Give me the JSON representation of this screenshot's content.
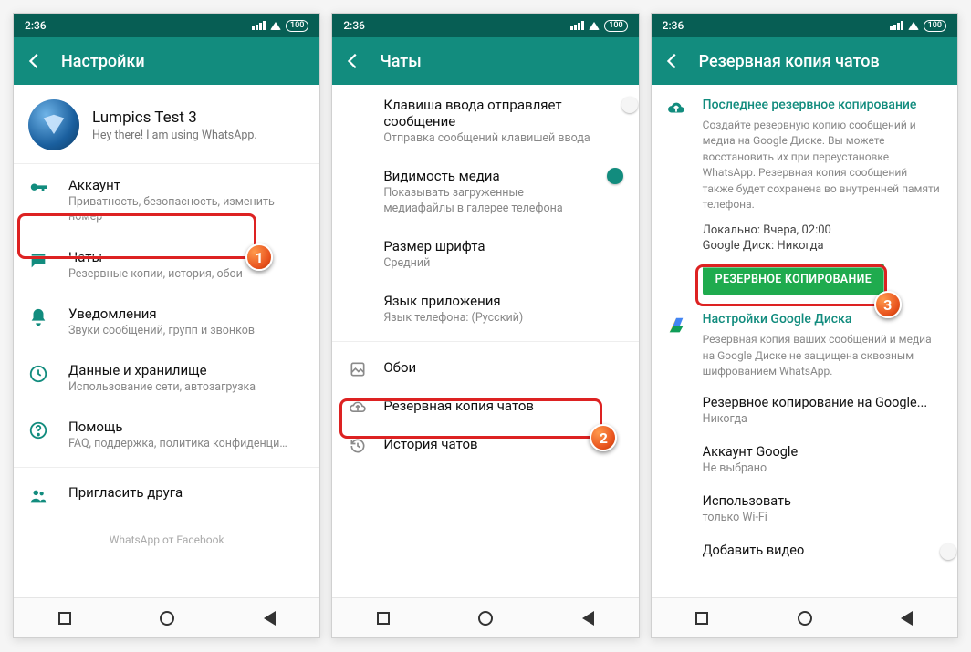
{
  "status": {
    "time": "2:36",
    "battery": "100"
  },
  "screen1": {
    "title": "Настройки",
    "profile": {
      "name": "Lumpics Test 3",
      "status": "Hey there! I am using WhatsApp."
    },
    "items": [
      {
        "icon": "key",
        "title": "Аккаунт",
        "sub": "Приватность, безопасность, изменить номер"
      },
      {
        "icon": "chat",
        "title": "Чаты",
        "sub": "Резервные копии, история, обои"
      },
      {
        "icon": "bell",
        "title": "Уведомления",
        "sub": "Звуки сообщений, групп и звонков"
      },
      {
        "icon": "data",
        "title": "Данные и хранилище",
        "sub": "Использование сети, автозагрузка"
      },
      {
        "icon": "help",
        "title": "Помощь",
        "sub": "FAQ, поддержка, политика конфиденциальн..."
      },
      {
        "icon": "invite",
        "title": "Пригласить друга",
        "sub": ""
      }
    ],
    "footer": "WhatsApp от Facebook"
  },
  "screen2": {
    "title": "Чаты",
    "items": [
      {
        "title": "Клавиша ввода отправляет сообщение",
        "sub": "Отправка сообщений клавишей ввода",
        "switch": "off"
      },
      {
        "title": "Видимость медиа",
        "sub": "Показывать загруженные медиафайлы в галерее телефона",
        "switch": "on"
      },
      {
        "title": "Размер шрифта",
        "sub": "Средний"
      },
      {
        "title": "Язык приложения",
        "sub": "Язык телефона: (Русский)"
      }
    ],
    "rows": [
      {
        "icon": "wall",
        "title": "Обои"
      },
      {
        "icon": "backup",
        "title": "Резервная копия чатов"
      },
      {
        "icon": "history",
        "title": "История чатов"
      }
    ]
  },
  "screen3": {
    "title": "Резервная копия чатов",
    "lastBackup": {
      "heading": "Последнее резервное копирование",
      "desc": "Создайте резервную копию сообщений и медиа на Google Диске. Вы можете восстановить их при переустановке WhatsApp. Резервная копия сообщений также будет сохранена во внутренней памяти телефона.",
      "local_label": "Локально:",
      "local_value": "Вчера, 02:00",
      "gdrive_label": "Google Диск:",
      "gdrive_value": "Никогда",
      "button": "РЕЗЕРВНОЕ КОПИРОВАНИЕ"
    },
    "gdrive": {
      "heading": "Настройки Google Диска",
      "desc": "Резервная копия ваших сообщений и медиа на Google Диске не защищена сквозным шифрованием WhatsApp."
    },
    "rows": [
      {
        "title": "Резервное копирование на Google...",
        "sub": "Никогда"
      },
      {
        "title": "Аккаунт Google",
        "sub": "Не выбрано"
      },
      {
        "title": "Использовать",
        "sub": "только Wi-Fi"
      },
      {
        "title": "Добавить видео",
        "sub": "",
        "switch": "off"
      }
    ]
  },
  "steps": {
    "one": "1",
    "two": "2",
    "three": "3"
  }
}
